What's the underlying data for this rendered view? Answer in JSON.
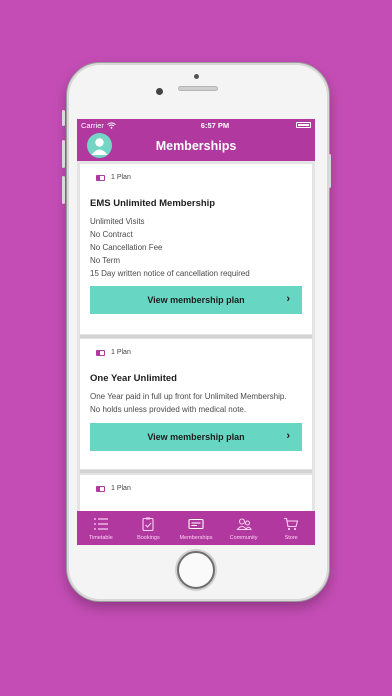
{
  "status": {
    "carrier": "Carrier",
    "time": "6:57 PM"
  },
  "header": {
    "title": "Memberships"
  },
  "cards": [
    {
      "plan_count": "1 Plan",
      "name": "EMS Unlimited Membership",
      "lines": [
        "Unlimited Visits",
        "No Contract",
        "No Cancellation Fee",
        "No Term",
        "15 Day written notice of cancellation required"
      ],
      "cta": "View membership plan"
    },
    {
      "plan_count": "1 Plan",
      "name": "One Year Unlimited",
      "lines": [
        "One Year paid in full up front for Unlimited Membership.",
        "No holds unless provided with medical note."
      ],
      "cta": "View membership plan"
    },
    {
      "plan_count": "1 Plan"
    }
  ],
  "tabs": [
    {
      "label": "Timetable",
      "icon": "list-icon"
    },
    {
      "label": "Bookings",
      "icon": "clipboard-icon"
    },
    {
      "label": "Memberships",
      "icon": "card-icon"
    },
    {
      "label": "Community",
      "icon": "people-icon"
    },
    {
      "label": "Store",
      "icon": "cart-icon"
    }
  ],
  "colors": {
    "background": "#c44db5",
    "brand": "#b0389f",
    "accent": "#67d7c4"
  }
}
